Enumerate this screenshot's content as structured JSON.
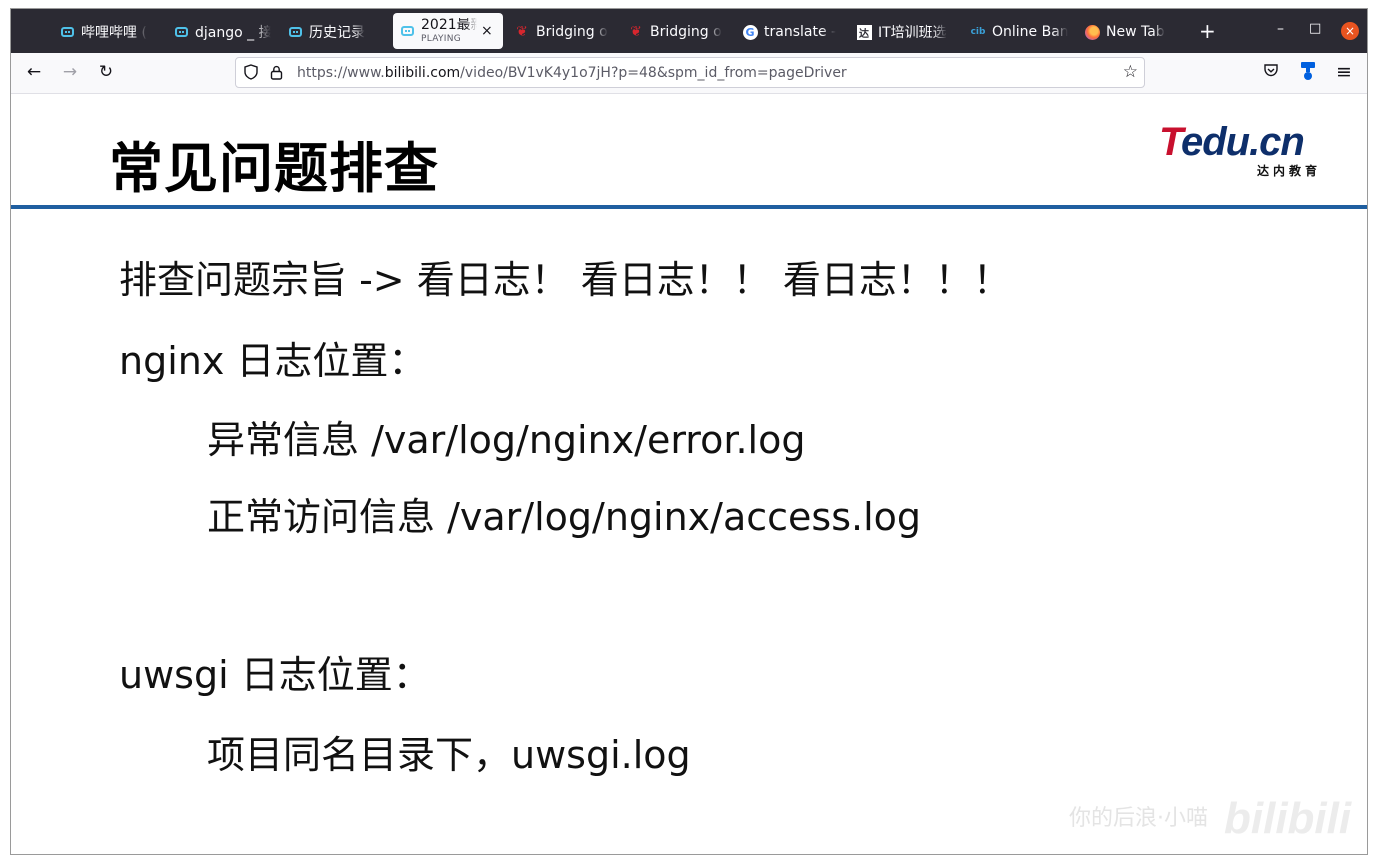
{
  "tabs": [
    {
      "label": "哔哩哔哩 (",
      "icon": "bilibili-icon"
    },
    {
      "label": "django _ 接",
      "icon": "bilibili-icon"
    },
    {
      "label": "历史记录",
      "icon": "bilibili-icon"
    },
    {
      "label": "2021最新",
      "sublabel": "PLAYING",
      "icon": "bilibili-icon",
      "active": true
    },
    {
      "label": "Bridging o",
      "icon": "maple-leaf-icon"
    },
    {
      "label": "Bridging o",
      "icon": "maple-leaf-icon"
    },
    {
      "label": "translate -",
      "icon": "google-icon"
    },
    {
      "label": "IT培训班选",
      "icon": "site-icon"
    },
    {
      "label": "Online Ban",
      "icon": "cibc-icon"
    },
    {
      "label": "New Tab",
      "icon": "firefox-icon"
    }
  ],
  "icons": {
    "close_tab": "×",
    "new_tab": "+",
    "minimize": "–",
    "maximize": "□",
    "close_window": "×",
    "back": "←",
    "forward": "→",
    "reload": "↻",
    "bookmark": "☆",
    "menu": "≡"
  },
  "urlbar": {
    "prefix": "https://www.",
    "domain": "bilibili.com",
    "path": "/video/BV1vK4y1o7jH?p=48&spm_id_from=pageDriver"
  },
  "slide": {
    "title": "常见问题排查",
    "logo_text": "Tedu.cn",
    "logo_sub": "达内教育",
    "lines": [
      "排查问题宗旨 -> 看日志！ 看日志！！ 看日志！！！",
      "nginx 日志位置：",
      "异常信息 /var/log/nginx/error.log",
      "正常访问信息 /var/log/nginx/access.log",
      "uwsgi 日志位置：",
      "项目同名目录下，uwsgi.log"
    ]
  },
  "watermark": {
    "text": "你的后浪·小喵",
    "brand": "bilibili"
  },
  "player": {
    "progress_fraction": 0.02
  },
  "colors": {
    "tabbar_bg": "#2b2a33",
    "accent_rule": "#1f5fa0",
    "bilibili_blue": "#00a1d6",
    "close_button": "#e95420"
  }
}
